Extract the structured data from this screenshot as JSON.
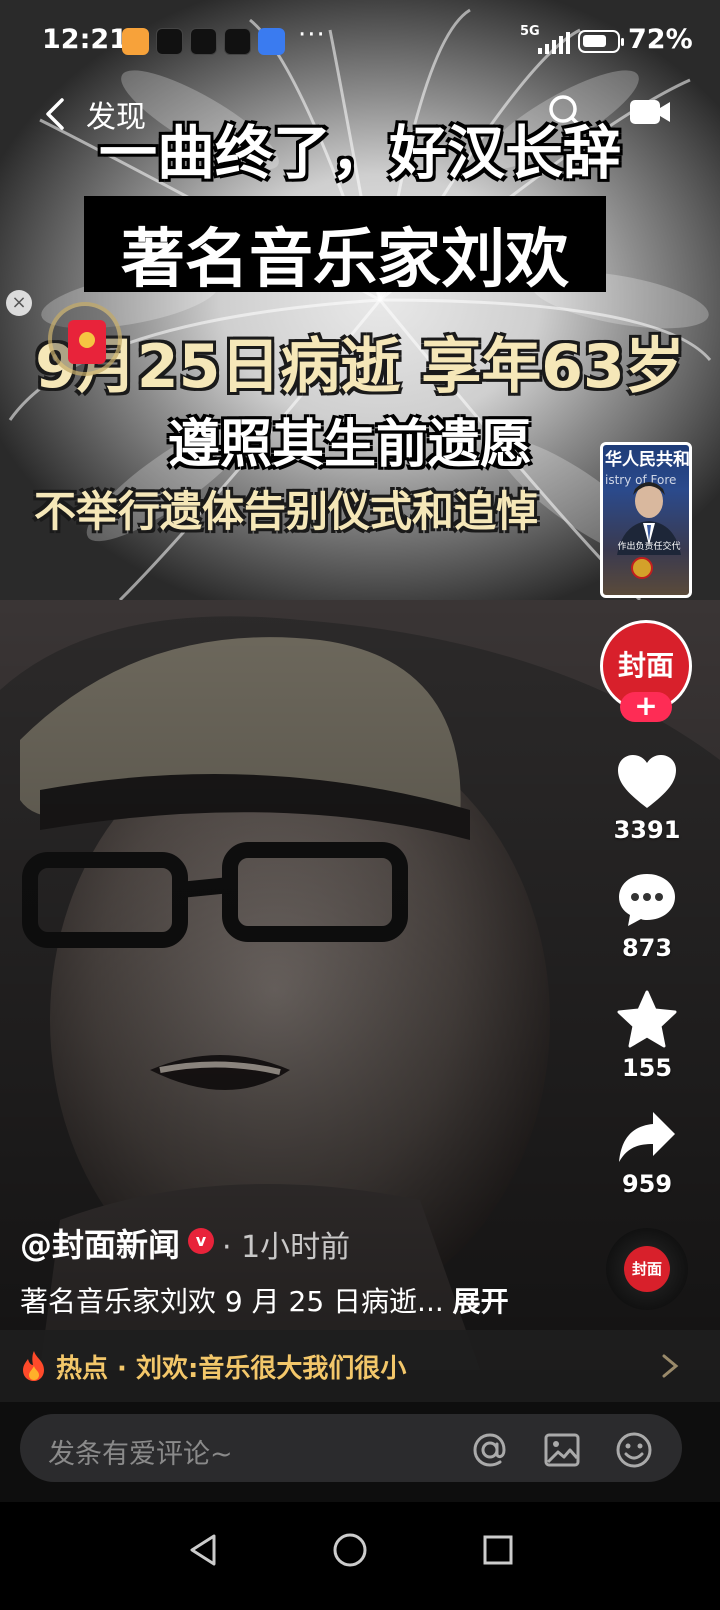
{
  "status_bar": {
    "time": "12:21",
    "more": "···",
    "network": "5G",
    "battery_percent": "72%",
    "battery_level": 0.72
  },
  "nav": {
    "back_icon": "chevron-left-icon",
    "title": "发现",
    "search_icon": "search-icon",
    "live_icon": "live-camera-icon"
  },
  "captions": {
    "line1": "一曲终了，好汉长辞",
    "line2": "著名音乐家刘欢",
    "line3": "9月25日病逝 享年63岁",
    "line4": "遵照其生前遗愿",
    "line5": "不举行遗体告别仪式和追悼"
  },
  "pip": {
    "header": "华人民共和",
    "subheader": "istry of Fore",
    "caption": "作出负责任交代"
  },
  "author_avatar": {
    "label": "封面",
    "follow": "+"
  },
  "actions": {
    "like_count": "3391",
    "comment_count": "873",
    "favorite_count": "155",
    "share_count": "959"
  },
  "music_disc_label": "封面",
  "post": {
    "author": "@封面新闻",
    "verified_mark": "v",
    "time": "· 1小时前",
    "description": "著名音乐家刘欢 9 月 25 日病逝... ",
    "expand": "展开"
  },
  "hot": {
    "text": "热点 · 刘欢:音乐很大我们很小"
  },
  "comment_bar": {
    "placeholder": "发条有爱评论~"
  },
  "colors": {
    "accent_red": "#fe2c55",
    "brand_red": "#d8202b",
    "caption_yellow": "#f5e7b8",
    "hot_yellow": "#f3c76a"
  }
}
